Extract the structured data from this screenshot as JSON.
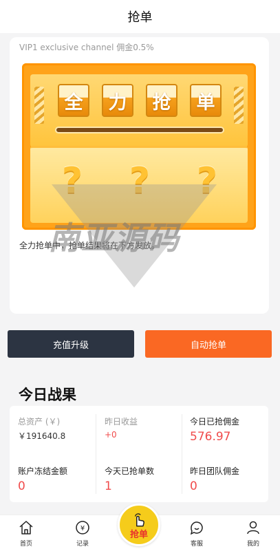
{
  "header": {
    "title": "抢单"
  },
  "channel": {
    "label": "VIP1 exclusive channel 佣金0.5%"
  },
  "machine": {
    "tiles": [
      "全",
      "力",
      "抢",
      "单"
    ],
    "slots": [
      "?",
      "?",
      "?"
    ]
  },
  "status_text": "全力抢单中，抢单结果将在下方发放。",
  "watermark": {
    "text": "南亚源码"
  },
  "buttons": {
    "upgrade": "充值升级",
    "auto_grab": "自动抢单"
  },
  "results": {
    "title": "今日战果",
    "stats": [
      {
        "label": "总资产 (￥)",
        "value": "￥191640.8"
      },
      {
        "label": "昨日收益",
        "value": "+0"
      },
      {
        "label": "今日已抢佣金",
        "value": "576.97"
      },
      {
        "label": "账户冻结金额",
        "value": "0"
      },
      {
        "label": "今天已抢单数",
        "value": "1"
      },
      {
        "label": "昨日团队佣金",
        "value": "0"
      }
    ]
  },
  "tabbar": {
    "home": "首页",
    "records": "记录",
    "grab": "抢单",
    "service": "客服",
    "mine": "我的"
  },
  "colors": {
    "accent_orange": "#fa6823",
    "dark_button": "#2c3442",
    "value_red": "#f04b4b",
    "grab_yellow": "#f5cc1b"
  }
}
